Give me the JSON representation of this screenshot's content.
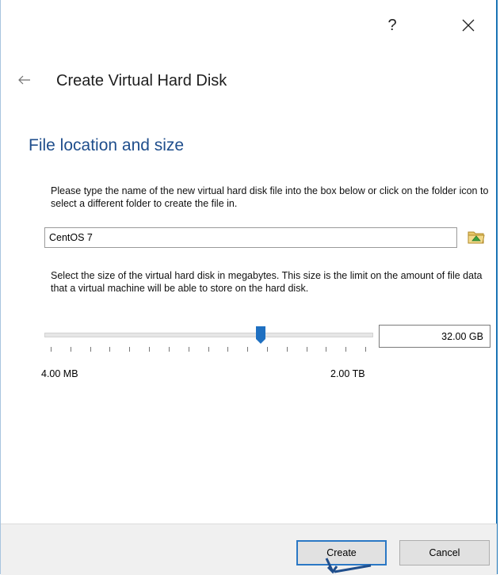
{
  "titlebar": {
    "help_label": "?"
  },
  "header": {
    "back_icon": "arrow-left-icon",
    "title": "Create Virtual Hard Disk"
  },
  "section": {
    "title": "File location and size"
  },
  "file_location": {
    "description": "Please type the name of the new virtual hard disk file into the box below or click on the folder icon to select a different folder to create the file in.",
    "value": "CentOS 7",
    "folder_icon": "folder-icon"
  },
  "size": {
    "description": "Select the size of the virtual hard disk in megabytes. This size is the limit on the amount of file data that a virtual machine will be able to store on the hard disk.",
    "value": "32.00 GB",
    "min_label": "4.00 MB",
    "max_label": "2.00 TB",
    "slider_fraction": 0.66
  },
  "footer": {
    "create_label": "Create",
    "cancel_label": "Cancel"
  },
  "colors": {
    "accent": "#1f4e8c",
    "focus_border": "#2b78c5",
    "thumb": "#1f70c1"
  }
}
